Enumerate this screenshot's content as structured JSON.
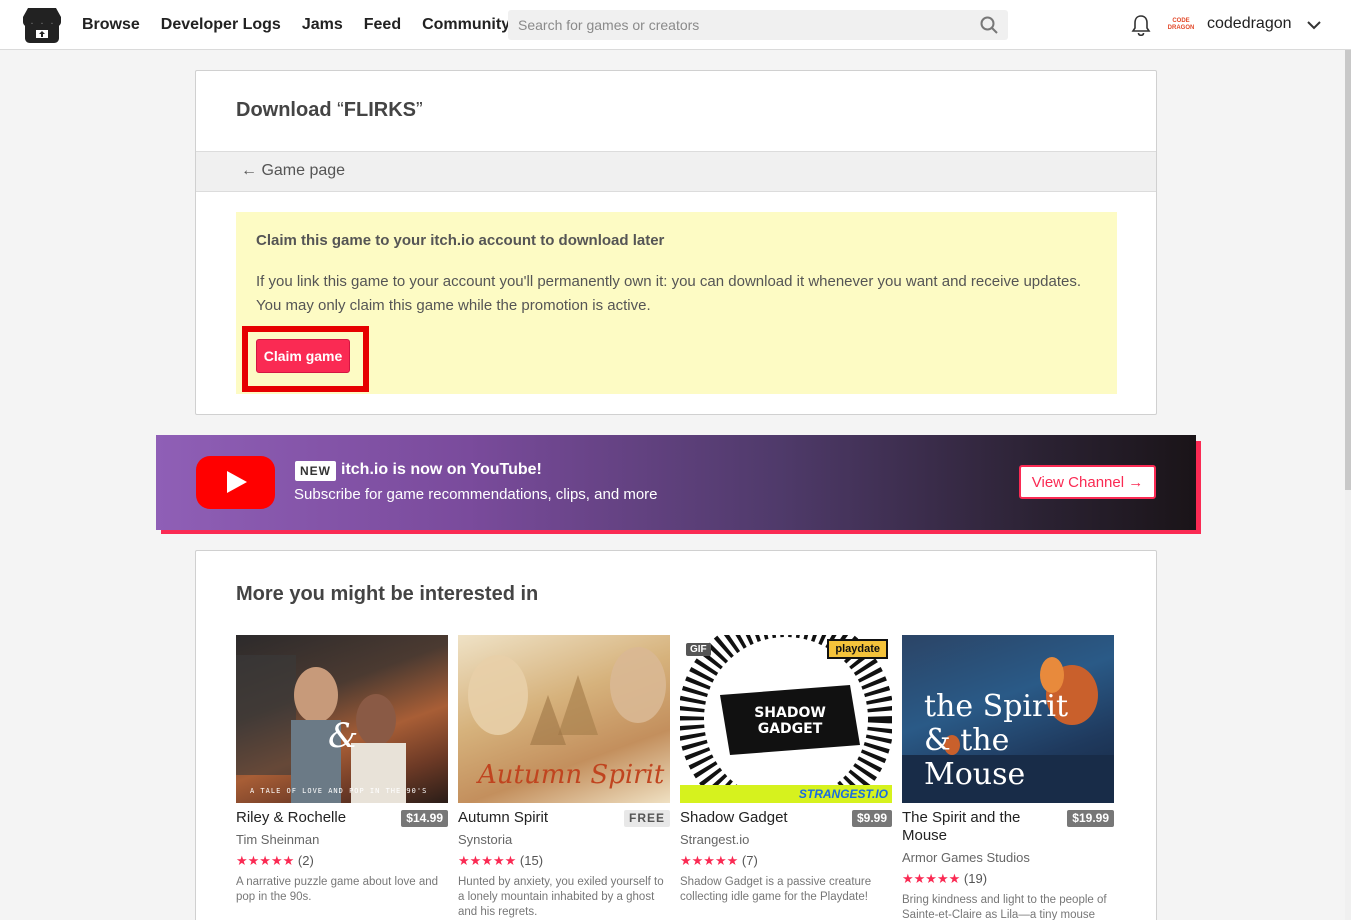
{
  "header": {
    "nav": [
      "Browse",
      "Developer Logs",
      "Jams",
      "Feed",
      "Community"
    ],
    "search_placeholder": "Search for games or creators",
    "avatar_text": "CODE DRAGON",
    "username": "codedragon"
  },
  "download": {
    "title_prefix": "Download ",
    "open_quote": "“",
    "game_name": "FLIRKS",
    "close_quote": "”",
    "back_link": "← Game page",
    "claim_heading": "Claim this game to your itch.io account to download later",
    "claim_text": "If you link this game to your account you'll permanently own it: you can download it whenever you want and receive updates. You may only claim this game while the promotion is active.",
    "claim_button": "Claim game"
  },
  "banner": {
    "new_tag": "NEW",
    "title": "itch.io is now on YouTube!",
    "subtitle": "Subscribe for game recommendations, clips, and more",
    "button": "View Channel →"
  },
  "more": {
    "heading": "More you might be interested in",
    "games": [
      {
        "title": "Riley & Rochelle",
        "price": "$14.99",
        "author": "Tim Sheinman",
        "stars": "★★★★★",
        "rating_count": "(2)",
        "description": "A narrative puzzle game about love and pop in the 90s.",
        "thumb_text": "A TALE OF LOVE AND POP IN THE 90'S"
      },
      {
        "title": "Autumn Spirit",
        "price": "FREE",
        "author": "Synstoria",
        "stars": "★★★★★",
        "rating_count": "(15)",
        "description": "Hunted by anxiety, you exiled yourself to a lonely mountain inhabited by a ghost and his regrets.",
        "thumb_text": "Autumn Spirit"
      },
      {
        "title": "Shadow Gadget",
        "price": "$9.99",
        "author": "Strangest.io",
        "stars": "★★★★★",
        "rating_count": "(7)",
        "description": "Shadow Gadget is a passive creature collecting idle game for the Playdate!",
        "gif_badge": "GIF",
        "playdate_badge": "playdate",
        "thumb_text": "SHADOW GADGET",
        "footer_text": "STRANGEST.IO"
      },
      {
        "title": "The Spirit and the Mouse",
        "price": "$19.99",
        "author": "Armor Games Studios",
        "stars": "★★★★★",
        "rating_count": "(19)",
        "description": "Bring kindness and light to the people of Sainte-et-Claire as Lila—a tiny mouse",
        "thumb_text": "the Spirit & the Mouse"
      }
    ]
  }
}
